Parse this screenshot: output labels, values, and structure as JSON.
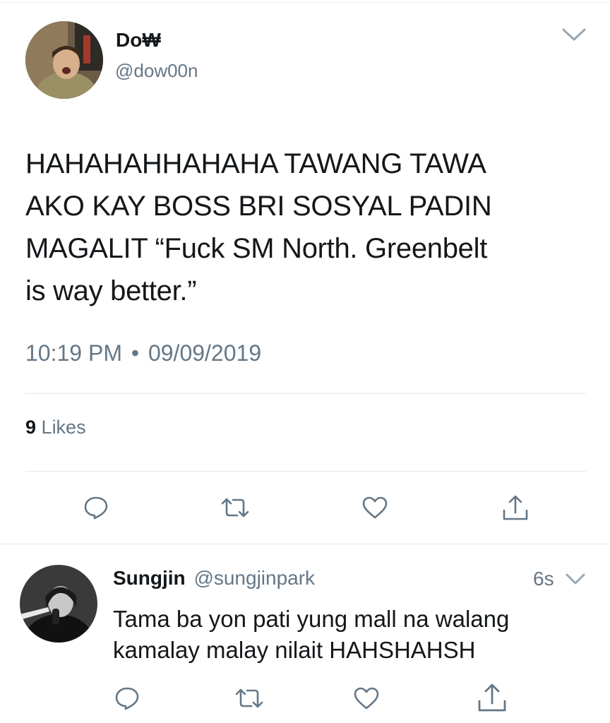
{
  "tweet": {
    "display_name": "Do₩",
    "handle": "@dow00n",
    "text_lines": [
      "HAHAHAHHAHAHA TAWANG TAWA",
      "AKO KAY BOSS BRI SOSYAL PADIN",
      "MAGALIT “Fuck SM North. Greenbelt",
      "is way better.”"
    ],
    "time": "10:19 PM",
    "separator": "•",
    "date": "09/09/2019",
    "likes_count": "9",
    "likes_label": "Likes",
    "avatar_icon": "user-photo"
  },
  "reply": {
    "display_name": "Sungjin",
    "handle": "@sungjinpark",
    "age": "6s",
    "text_lines": [
      "Tama ba yon pati yung mall na walang",
      "kamalay malay nilait HAHSHAHSH"
    ],
    "avatar_icon": "user-photo"
  },
  "actions": [
    "reply-icon",
    "retweet-icon",
    "like-icon",
    "share-icon"
  ],
  "colors": {
    "text": "#14171a",
    "secondary": "#657786",
    "divider": "#e1e8ed",
    "icon": "#657786"
  }
}
